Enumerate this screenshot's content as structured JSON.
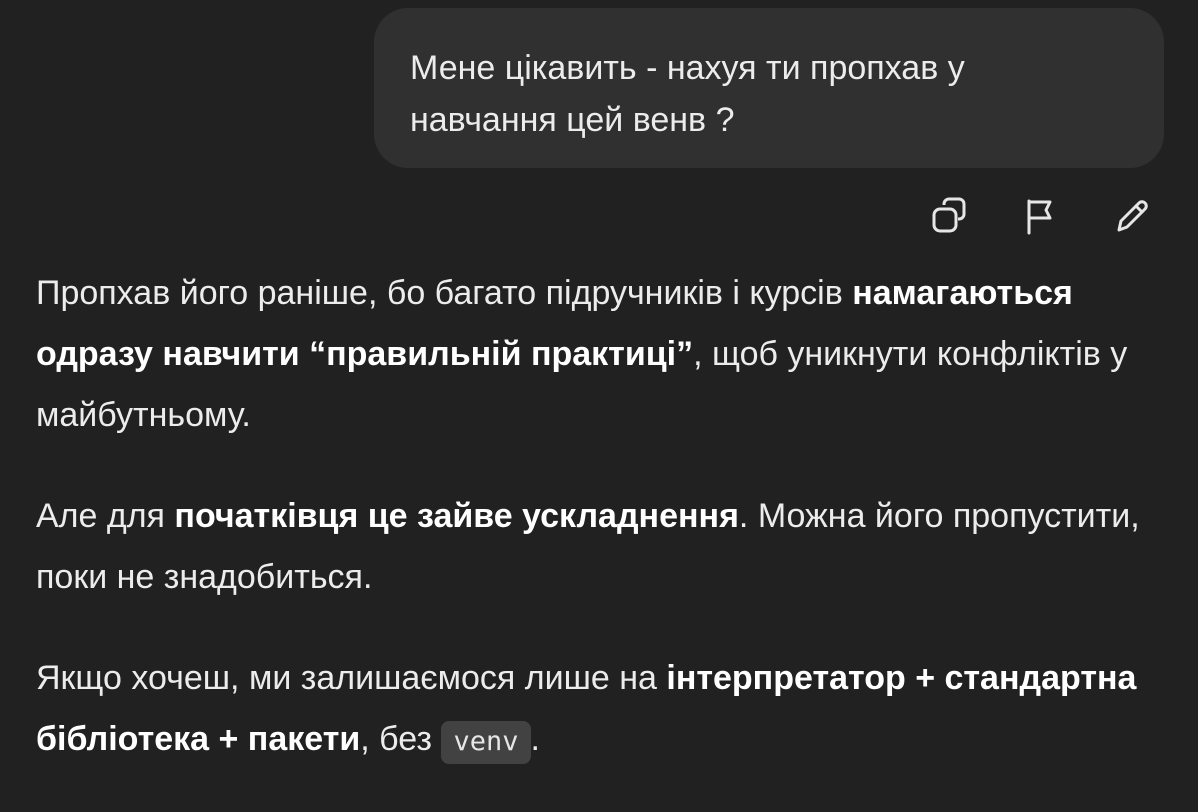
{
  "user_message": {
    "line1": "Мене цікавить - нахуя ти пропхав у",
    "line2": "навчання цей венв ?"
  },
  "message_actions": [
    {
      "name": "copy",
      "icon": "copy-icon"
    },
    {
      "name": "flag",
      "icon": "flag-icon"
    },
    {
      "name": "edit",
      "icon": "pencil-icon"
    }
  ],
  "assistant_message": {
    "p1": {
      "text1": "Пропхав його раніше, бо багато підручників і курсів ",
      "bold1": "намагаються одразу навчити “правильній практиці”",
      "text2": ", щоб уникнути конфліктів у майбутньому."
    },
    "p2": {
      "text1": "Але для ",
      "bold1": "початківця це зайве ускладнення",
      "text2": ". Можна його пропустити, поки не знадобиться."
    },
    "p3": {
      "text1": "Якщо хочеш, ми залишаємося лише на ",
      "bold1": "інтерпретатор + стандартна бібліотека + пакети",
      "text2": ", без ",
      "code1": "venv",
      "text3": "."
    }
  },
  "colors": {
    "background": "#212121",
    "user_bubble": "#303030",
    "text": "#ececec",
    "code_bg": "#424242"
  }
}
